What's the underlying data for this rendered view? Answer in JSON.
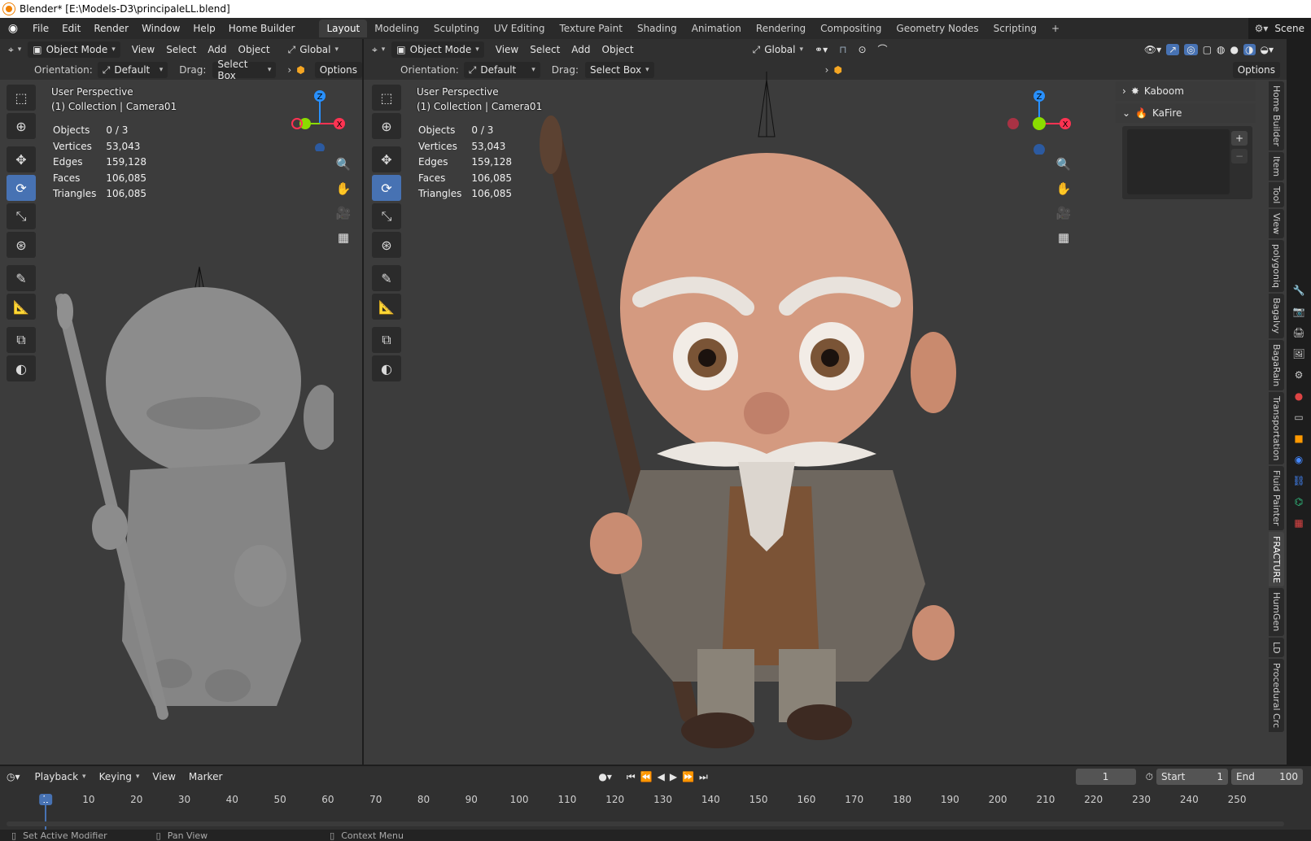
{
  "window_title": "Blender* [E:\\Models-D3\\principaleLL.blend]",
  "menu": [
    "File",
    "Edit",
    "Render",
    "Window",
    "Help",
    "Home Builder"
  ],
  "workspaces": [
    "Layout",
    "Modeling",
    "Sculpting",
    "UV Editing",
    "Texture Paint",
    "Shading",
    "Animation",
    "Rendering",
    "Compositing",
    "Geometry Nodes",
    "Scripting"
  ],
  "active_workspace": "Layout",
  "scene": "Scene",
  "left_view": {
    "mode": "Object Mode",
    "menus": [
      "View",
      "Select",
      "Add",
      "Object"
    ],
    "transform": "Global",
    "orientation_label": "Orientation:",
    "orientation_value": "Default",
    "drag_label": "Drag:",
    "drag_value": "Select Box",
    "options": "Options",
    "perspective": "User Perspective",
    "collection": "(1) Collection | Camera01",
    "stats": [
      {
        "label": "Objects",
        "value": "0 / 3"
      },
      {
        "label": "Vertices",
        "value": "53,043"
      },
      {
        "label": "Edges",
        "value": "159,128"
      },
      {
        "label": "Faces",
        "value": "106,085"
      },
      {
        "label": "Triangles",
        "value": "106,085"
      }
    ]
  },
  "right_view": {
    "mode": "Object Mode",
    "menus": [
      "View",
      "Select",
      "Add",
      "Object"
    ],
    "transform": "Global",
    "orientation_label": "Orientation:",
    "orientation_value": "Default",
    "drag_label": "Drag:",
    "drag_value": "Select Box",
    "options": "Options",
    "perspective": "User Perspective",
    "collection": "(1) Collection | Camera01",
    "stats": [
      {
        "label": "Objects",
        "value": "0 / 3"
      },
      {
        "label": "Vertices",
        "value": "53,043"
      },
      {
        "label": "Edges",
        "value": "159,128"
      },
      {
        "label": "Faces",
        "value": "106,085"
      },
      {
        "label": "Triangles",
        "value": "106,085"
      }
    ]
  },
  "gizmo": {
    "z": "Z",
    "x": "X"
  },
  "npanel": {
    "panels": [
      "Kaboom",
      "KaFire"
    ],
    "tabs": [
      "Home Builder",
      "Item",
      "Tool",
      "View",
      "polygoniq",
      "Bagalvy",
      "BagaRain",
      "Transportation",
      "Fluid Painter",
      "FRACTURE",
      "HumGen",
      "LD",
      "Procedural Crc"
    ],
    "active_tab": "FRACTURE"
  },
  "timeline": {
    "menus": [
      "Playback",
      "Keying",
      "View",
      "Marker"
    ],
    "current_frame": "1",
    "start_label": "Start",
    "start": "1",
    "end_label": "End",
    "end": "100",
    "ticks": [
      "1",
      "10",
      "20",
      "30",
      "40",
      "50",
      "60",
      "70",
      "80",
      "90",
      "100",
      "110",
      "120",
      "130",
      "140",
      "150",
      "160",
      "170",
      "180",
      "190",
      "200",
      "210",
      "220",
      "230",
      "240",
      "250"
    ]
  },
  "status": [
    "Set Active Modifier",
    "Pan View",
    "Context Menu"
  ],
  "colors": {
    "accent": "#4772b3",
    "x_axis": "#ff3352",
    "y_axis": "#8bdc00",
    "z_axis": "#2890ff"
  }
}
